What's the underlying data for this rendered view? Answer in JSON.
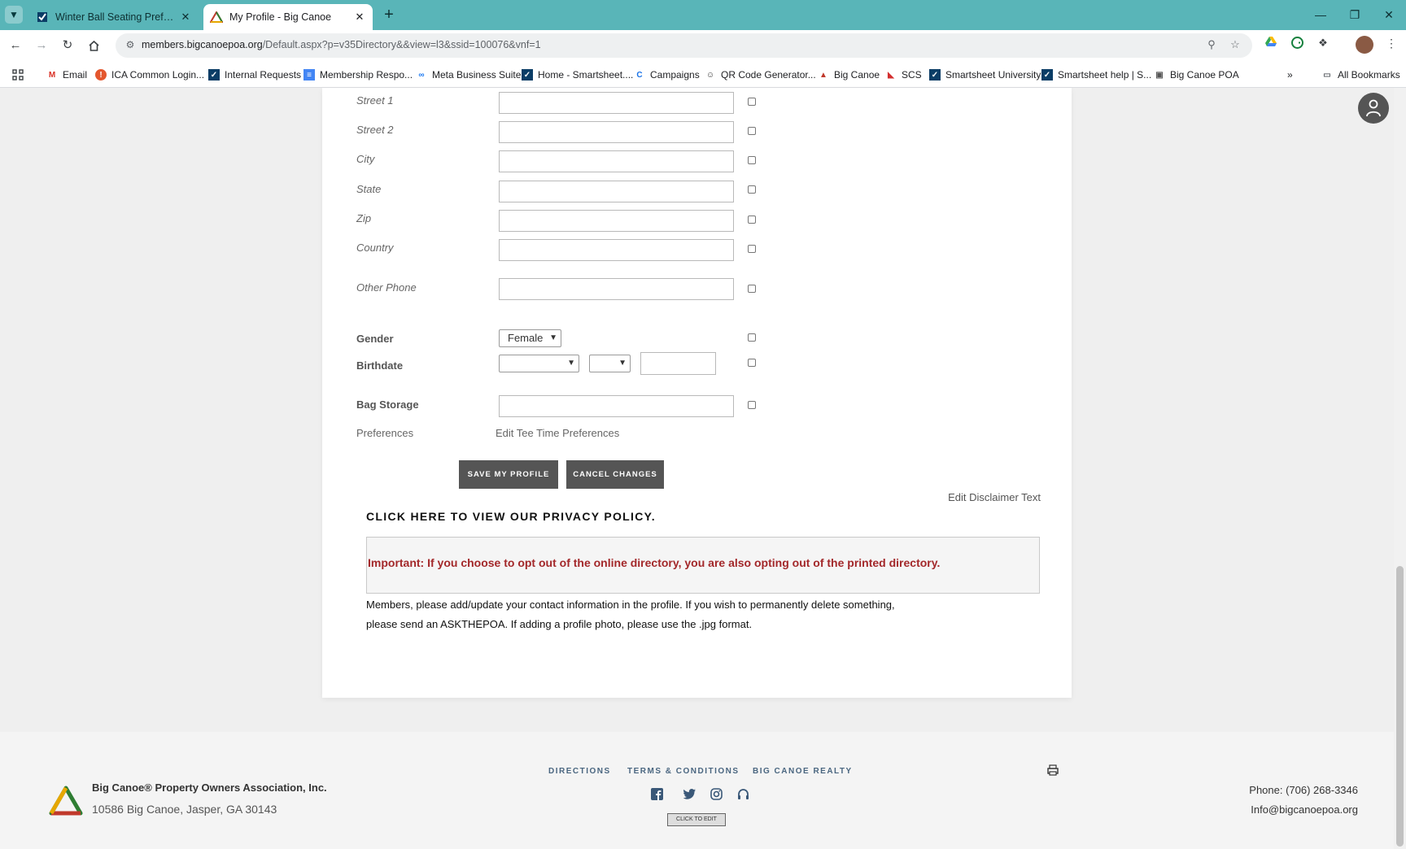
{
  "browser": {
    "tabs": [
      {
        "title": "Winter Ball Seating Preferences",
        "active": false
      },
      {
        "title": "My Profile - Big Canoe",
        "active": true
      }
    ],
    "url_host": "members.bigcanoepoa.org",
    "url_path": "/Default.aspx?p=v35Directory&&view=l3&ssid=100076&vnf=1",
    "bookmarks": [
      "Email",
      "ICA Common Login...",
      "Internal Requests",
      "Membership Respo...",
      "Meta Business Suite",
      "Home - Smartsheet....",
      "Campaigns",
      "QR Code Generator...",
      "Big Canoe",
      "SCS",
      "Smartsheet University",
      "Smartsheet help | S...",
      "Big Canoe POA"
    ],
    "all_bookmarks": "All Bookmarks"
  },
  "form": {
    "street1": "Street 1",
    "street2": "Street 2",
    "city": "City",
    "state": "State",
    "zip": "Zip",
    "country": "Country",
    "other_phone": "Other Phone",
    "gender_label": "Gender",
    "gender_value": "Female",
    "birthdate_label": "Birthdate",
    "bag_storage_label": "Bag Storage",
    "preferences_label": "Preferences",
    "edit_tee": "Edit Tee Time Preferences",
    "save_btn": "SAVE MY PROFILE",
    "cancel_btn": "CANCEL CHANGES",
    "edit_disclaimer": "Edit Disclaimer Text",
    "privacy": "CLICK HERE TO VIEW OUR PRIVACY POLICY.",
    "important": "Important: If you choose to opt out of the online directory, you are also opting out of the printed directory.",
    "members_line1": "Members, please add/update your contact information in the profile. If you wish to permanently delete something,",
    "members_line2": "please send an ASKTHEPOA. If adding a profile photo, please use the .jpg format."
  },
  "footer": {
    "org": "Big Canoe® Property Owners Association, Inc.",
    "address": "10586 Big Canoe, Jasper, GA 30143",
    "links": [
      "DIRECTIONS",
      "TERMS & CONDITIONS",
      "BIG CANOE REALTY"
    ],
    "click_to_edit": "CLICK TO EDIT",
    "phone": "Phone: (706) 268-3346",
    "email": "Info@bigcanoepoa.org"
  },
  "colors": {
    "tabbar": "#59b5b8",
    "notice_text": "#a3282a",
    "button": "#555555"
  }
}
